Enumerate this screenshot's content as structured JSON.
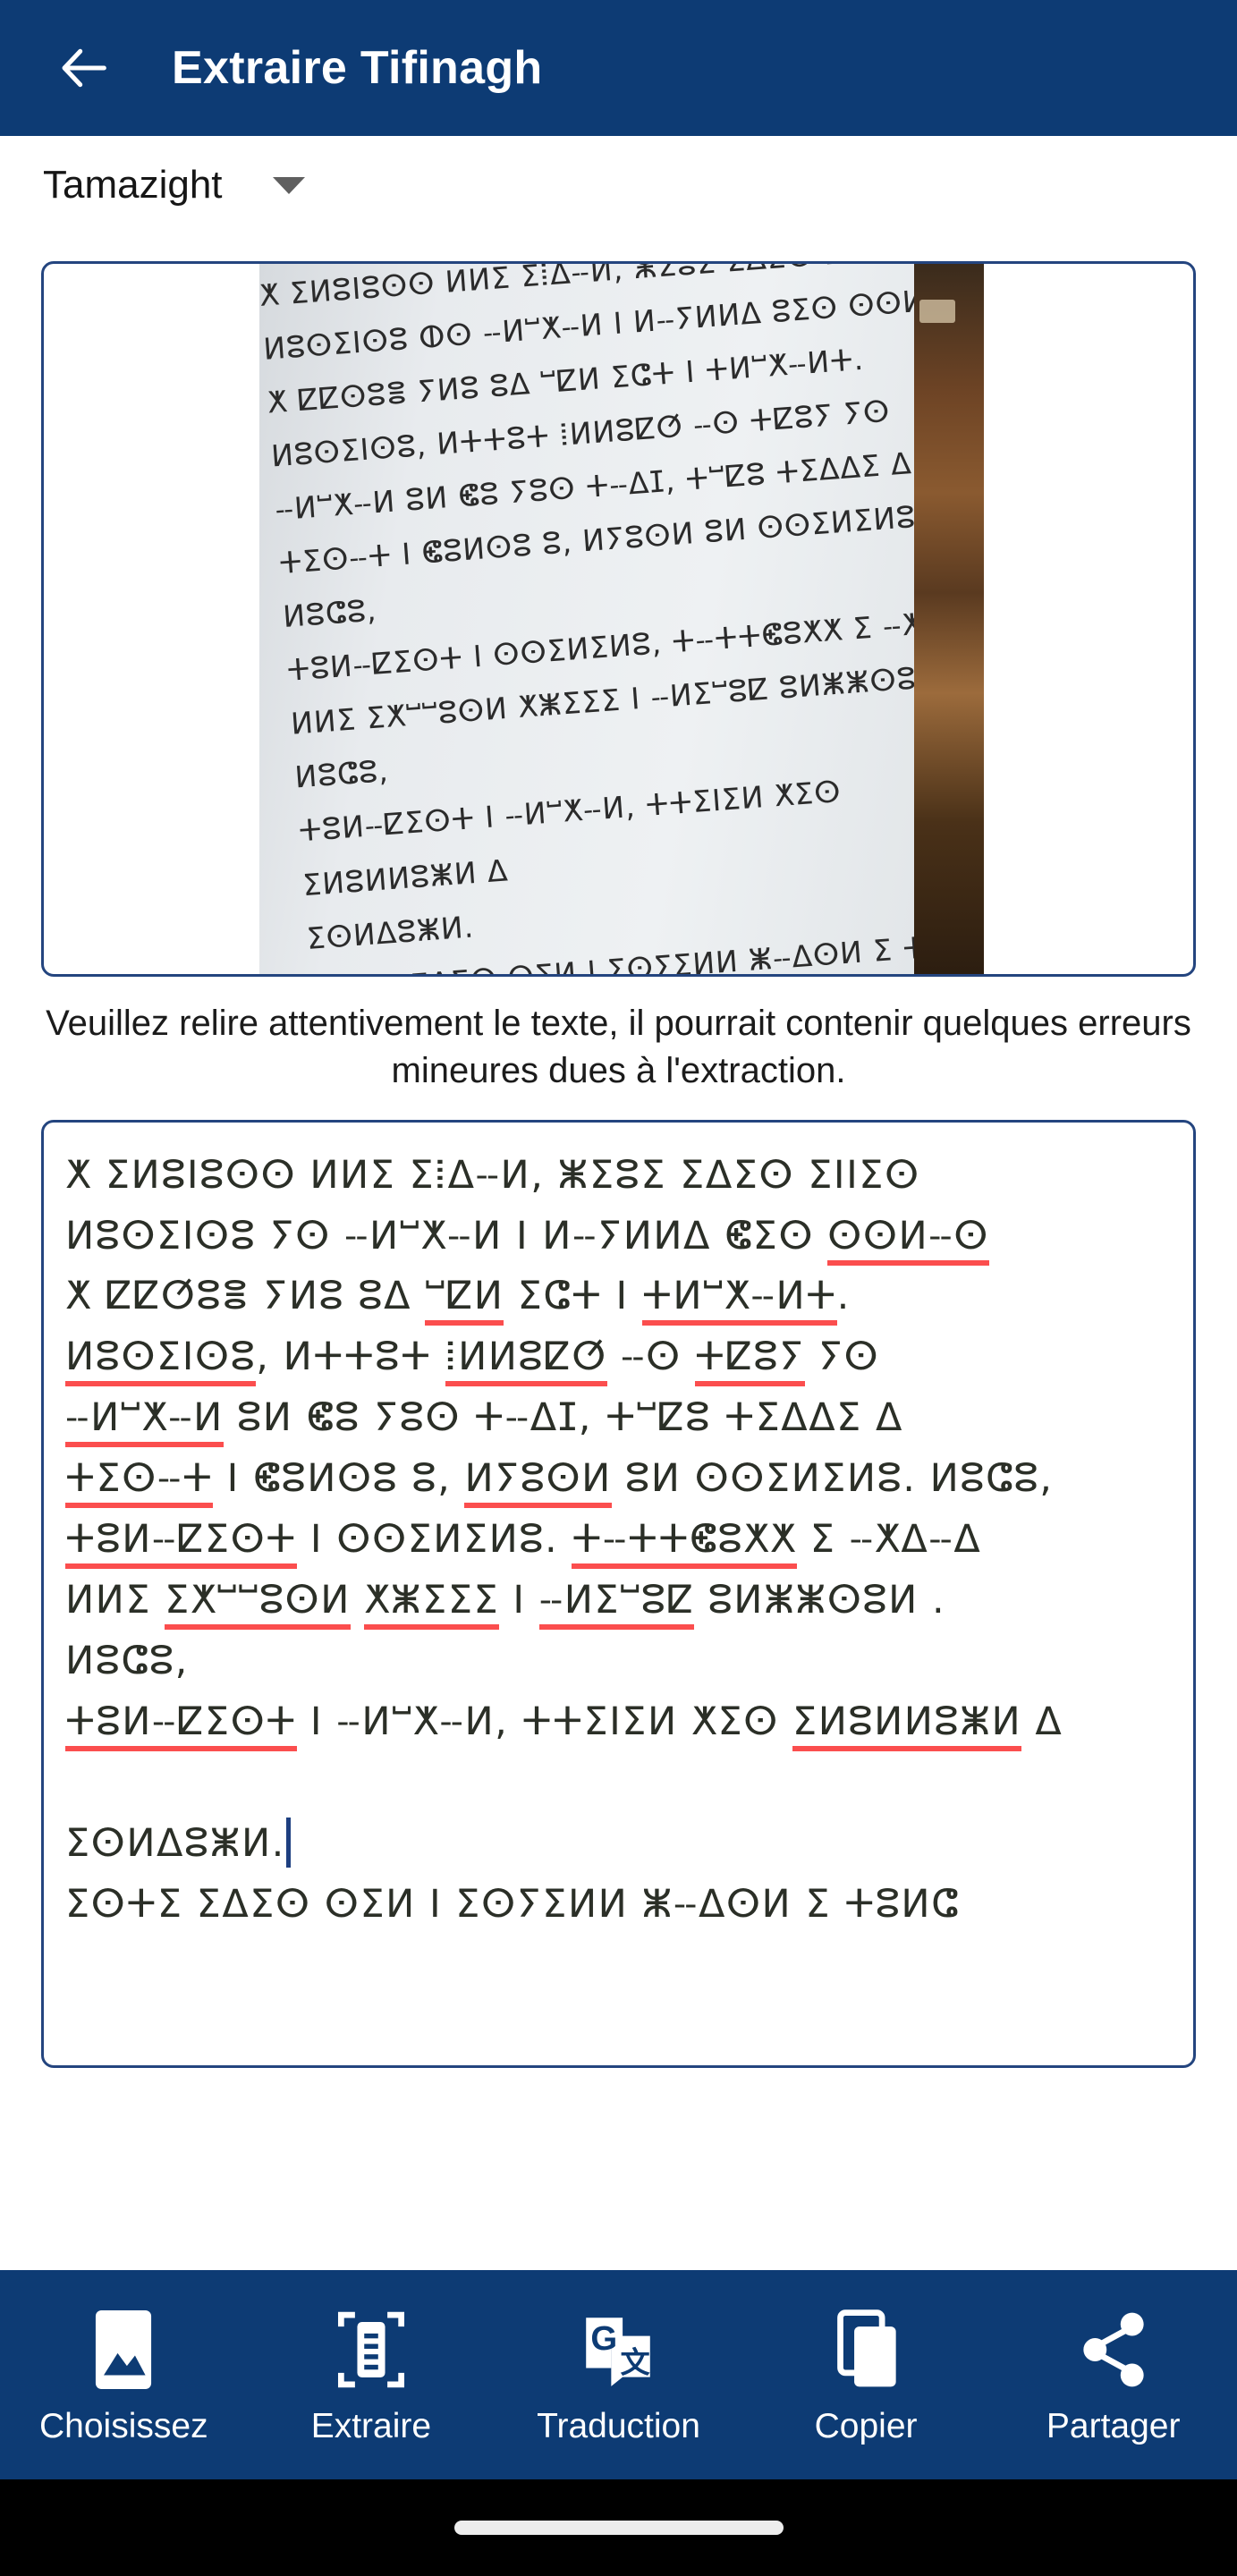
{
  "appbar": {
    "back_icon": "arrow-left-icon",
    "title": "Extraire Tifinagh"
  },
  "language_selector": {
    "value": "Tamazight",
    "caret_icon": "chevron-down-icon"
  },
  "preview": {
    "photo_alt": "photo of printed Tifinagh text on white paper",
    "photo_text": "ⵅ ⵉⵍⵓⵏⵓⵙⵙ ⵍⵍⵉ ⵉⵂⵠⵧⵍ, ⵥⵉⵓⵉ ⵉⵠⵉⵙ ⵉⵏⵏⵉⵙ\nⵍⵓⵙⵉⵏⵙⵓ ⵀⵙ ⵧⵍⵯⵅⵧⵍ I ⵍⵧⵢⵍⵍⵠ ⵓⵉⵙ ⵙⵙⵍⵧⵙ\nⵅ ⵇⵇⵙⵓⴻ ⵢⵍⵓ ⵓⵠ ⵯⵇⵍ ⵉⵛⵜ I ⵜⵍⵯⵅⵧⵍⵜ.\nⵍⵓⵙⵉⵏⵙⵓ, ⵍⵜⵜⵓⵜ ⵂⵍⵍⵓⵇⵚ ⵧⵙ ⵜⵇⵓⵢ ⵢⵙ\nⵧⵍⵯⵅⵧⵍ ⵓⵍ ⵞⵓ ⵢⵓⵙ ⵜⵧⵠⵊ, ⵜⵯⵇⵓ ⵜⵉⵠⵠⵉ ⵠ\nⵜⵉⵙⵧⵜ I ⵞⵓⵍⵙⵓ ⵓ, ⵍⵢⵓⵙⵍ ⵓⵍ ⵙⵙⵉⵍⵉⵍⵓ. ⵍⵓⵛⵓ,\nⵜⵓⵍⵧⵇⵉⵙⵜ I ⵙⵙⵉⵍⵉⵍⵓ, ⵜⵧⵜⵜⵞⵓⵅⵅ ⵉ ⵧⵅⵠⵧⵠ\nⵍⵍⵉ ⵉⵅⵯⵯⵓⵙⵍ ⵅⵥⵉⵉⵉ I ⵧⵍⵉⵯⵓⵇ ⵓⵍⵥⵥⵙⵓⵍ. ⵍⵓⵛⵓ,\nⵜⵓⵍⵧⵇⵉⵙⵜ I ⵧⵍⵯⵅⵧⵍ, ⵜⵜⵉⵏⵉⵍ ⵅⵉⵙ ⵉⵍⵓⵍⵍⵓⵥⵍ ⵠ\nⵉⵙⵍⵠⵓⵥⵍ.\nⵉⵙⵜⵉ ⵉⵠⵉⵙ ⵙⵉⵍ I ⵉⵙⵢⵉⵍⵍ ⵥⵧⵠⵙⵍ ⵉ ⵜⵓⵍⵛ\nⵍⵙ, ⵜⵧⵜⵜⵇⵓⵍⵓ ⵓⵙⵍⵜⵉ I ⵜⵍⵯⵅⵧⵍⵜ. ⵛⵞⵓⵥⵜ, ⵜⵙ\nⵍⵓⵇⵇⵓ ⵞⵉⵙ ⵉⵏⵏⵓⵍ ⵅ ⵜⵍⵧⵇⵉⵙⵜ, ⵉⵜⵜⵞⵓⵯⵯⵙ"
  },
  "hint": {
    "text": "Veuillez relire attentivement le texte, il pourrait contenir quelques erreurs mineures dues à l'extraction."
  },
  "extracted_text": {
    "lines": [
      {
        "id": "l1",
        "text": "ⵅ ⵉⵍⵓⵏⵓⵙⵙ ⵍⵍⵉ ⵉⵂⵠⵧⵍ, ⵥⵉⵓⵉ ⵉⵠⵉⵙ ⵉⵏⵏⵉⵙ",
        "errors": []
      },
      {
        "id": "l2",
        "text": "ⵍⵓⵙⵉⵏⵙⵓ ⵢⵙ ⵧⵍⵯⵅⵧⵍ I ⵍⵧⵢⵍⵍⵠ ⵞⵉⵙ ⵙⵙⵍⵧⵙ",
        "errors": [
          "ⵙⵙⵍⵧⵙ"
        ]
      },
      {
        "id": "l3",
        "text": "ⵅ ⵇⵇⵚⵓⴻ ⵢⵍⵓ ⵓⵠ ⵯⵇⵍ ⵉⵛⵜ I ⵜⵍⵯⵅⵧⵍⵜ.",
        "errors": [
          "ⵯⵇⵍ",
          "ⵜⵍⵯⵅⵧⵍⵜ"
        ]
      },
      {
        "id": "l4",
        "text": "ⵍⵓⵙⵉⵏⵙⵓ, ⵍⵜⵜⵓⵜ ⵂⵍⵍⵓⵇⵚ ⵧⵙ ⵜⵇⵓⵢ ⵢⵙ",
        "errors": [
          "ⵍⵓⵙⵉⵏⵙⵓ",
          "ⵂⵍⵍⵓⵇⵚ",
          "ⵜⵇⵓⵢ"
        ]
      },
      {
        "id": "l5",
        "text": "ⵧⵍⵯⵅⵧⵍ ⵓⵍ ⵞⵓ ⵢⵓⵙ ⵜⵧⵠⵊ, ⵜⵯⵇⵓ ⵜⵉⵠⵠⵉ ⵠ",
        "errors": [
          "ⵧⵍⵯⵅⵧⵍ"
        ]
      },
      {
        "id": "l6",
        "text": "ⵜⵉⵙⵧⵜ I ⵞⵓⵍⵙⵓ ⵓ, ⵍⵢⵓⵙⵍ ⵓⵍ ⵙⵙⵉⵍⵉⵍⵓ. ⵍⵓⵛⵓ,",
        "errors": [
          "ⵜⵉⵙⵧⵜ",
          "ⵍⵢⵓⵙⵍ"
        ]
      },
      {
        "id": "l7",
        "text": "ⵜⵓⵍⵧⵇⵉⵙⵜ I ⵙⵙⵉⵍⵉⵍⵓ. ⵜⵧⵜⵜⵞⵓⵅⵅ ⵉ ⵧⵅⵠⵧⵠ",
        "errors": [
          "ⵜⵓⵍⵧⵇⵉⵙⵜ",
          "ⵜⵧⵜⵜⵞⵓⵅⵅ"
        ]
      },
      {
        "id": "l8",
        "text": "ⵍⵍⵉ ⵉⵅⵯⵯⵓⵙⵍ ⵅⵥⵉⵉⵉ I ⵧⵍⵉⵯⵓⵇ ⵓⵍⵥⵥⵙⵓⵍ .",
        "errors": [
          "ⵉⵅⵯⵯⵓⵙⵍ",
          "ⵅⵥⵉⵉⵉ",
          "ⵧⵍⵉⵯⵓⵇ"
        ]
      },
      {
        "id": "l9",
        "text": "ⵍⵓⵛⵓ,",
        "errors": []
      },
      {
        "id": "l10",
        "text": "ⵜⵓⵍⵧⵇⵉⵙⵜ I ⵧⵍⵯⵅⵧⵍ, ⵜⵜⵉⵏⵉⵍ ⵅⵉⵙ ⵉⵍⵓⵍⵍⵓⵥⵍ ⵠ",
        "errors": [
          "ⵜⵓⵍⵧⵇⵉⵙⵜ",
          "ⵉⵍⵓⵍⵍⵓⵥⵍ"
        ]
      },
      {
        "id": "l11",
        "text": "",
        "errors": []
      },
      {
        "id": "l12",
        "text": "ⵉⵙⵍⵠⵓⵥⵍ.",
        "errors": [],
        "caret": true
      },
      {
        "id": "l13",
        "text": "ⵉⵙⵜⵉ ⵉⵠⵉⵙ ⵙⵉⵍ I ⵉⵙⵢⵉⵍⵍ ⵥⵧⵠⵙⵍ ⵉ ⵜⵓⵍⵛ",
        "errors": []
      }
    ]
  },
  "bottom_nav": {
    "items": [
      {
        "id": "choisissez",
        "label": "Choisissez",
        "icon": "image-icon"
      },
      {
        "id": "extraire",
        "label": "Extraire",
        "icon": "document-scan-icon"
      },
      {
        "id": "traduction",
        "label": "Traduction",
        "icon": "google-translate-icon"
      },
      {
        "id": "copier",
        "label": "Copier",
        "icon": "copy-icon"
      },
      {
        "id": "partager",
        "label": "Partager",
        "icon": "share-icon"
      }
    ]
  },
  "gesture_bar": {
    "pill": "home-indicator"
  },
  "colors": {
    "primary": "#0d3b74",
    "border": "#24457f",
    "error_underline": "#fb4e4e",
    "caret": "#1d3f80",
    "text": "#2b2f27"
  }
}
